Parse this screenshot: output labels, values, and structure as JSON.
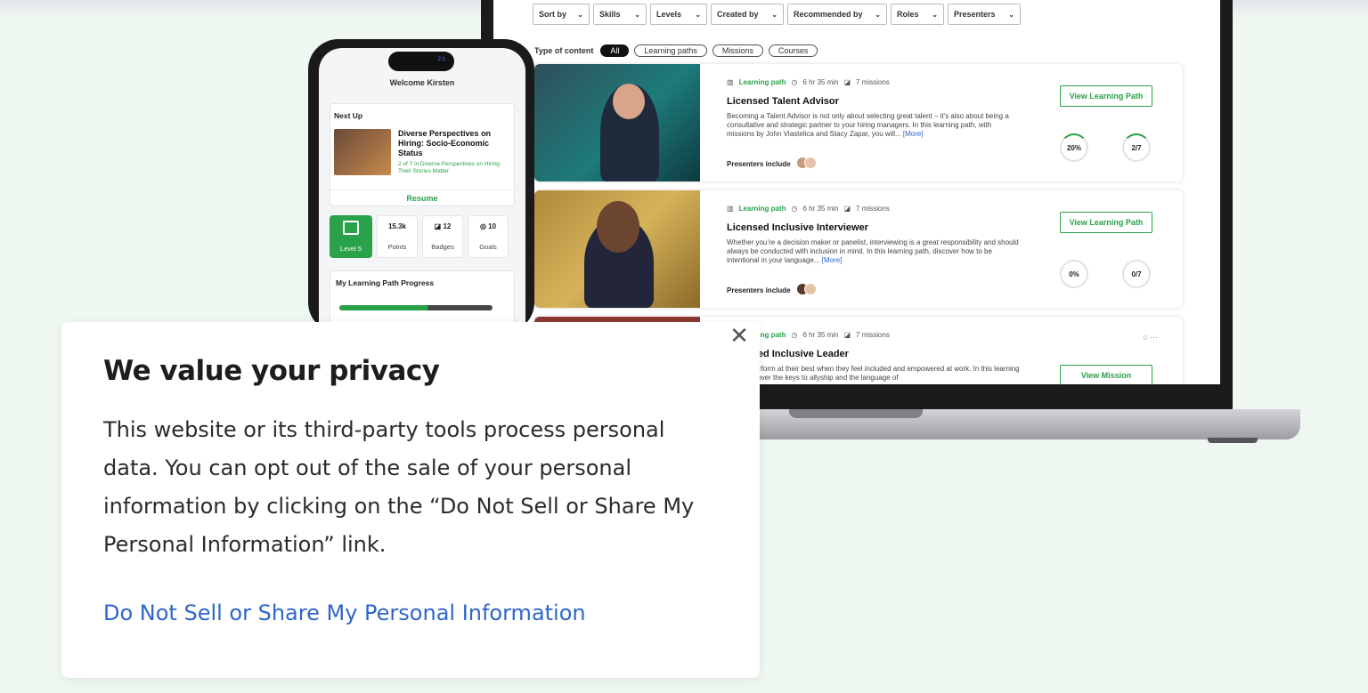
{
  "laptop": {
    "filters": [
      {
        "label": "Sort by",
        "width": 64
      },
      {
        "label": "Skills",
        "width": 60
      },
      {
        "label": "Levels",
        "width": 64
      },
      {
        "label": "Created by",
        "width": 82
      },
      {
        "label": "Recommended by",
        "width": 112
      },
      {
        "label": "Roles",
        "width": 60
      },
      {
        "label": "Presenters",
        "width": 82
      }
    ],
    "type_of_content_label": "Type of content",
    "chips": [
      "All",
      "Learning paths",
      "Missions",
      "Courses"
    ],
    "cards": [
      {
        "type": "Learning path",
        "duration": "6 hr 35 min",
        "missions": "7 missions",
        "title": "Licensed Talent Advisor",
        "description": "Becoming a Talent Advisor is not only about selecting great talent – it’s also about being a consultative and strategic partner to your hiring managers. In this learning path, with missions by John Vlastelica and Stacy Zapar, you will...",
        "more": "[More]",
        "presenters_label": "Presenters include",
        "button": "View Learning Path",
        "percent": "20%",
        "progress": "2/7"
      },
      {
        "type": "Learning path",
        "duration": "6 hr 35 min",
        "missions": "7 missions",
        "title": "Licensed Inclusive Interviewer",
        "description": "Whether you’re a decision maker or panelist, interviewing is a great responsibility and should always be conducted with inclusion in mind. In this learning path, discover how to be intentional in your language...",
        "more": "[More]",
        "presenters_label": "Presenters include",
        "button": "View Learning Path",
        "percent": "0%",
        "progress": "0/7"
      },
      {
        "type": "Learning path",
        "duration": "6 hr 35 min",
        "missions": "7 missions",
        "title": "Licensed Inclusive Leader",
        "description": "People perform at their best when they feel included and empowered at work. In this learning path, discover the keys to allyship and the language of",
        "button": "View Mission",
        "chat": "○ ···"
      }
    ]
  },
  "phone": {
    "status": "2:1",
    "welcome": "Welcome Kirsten",
    "next_up_label": "Next Up",
    "next_title": "Diverse Perspectives on Hiring: Socio-Economic Status",
    "next_sub": "2 of 7 in Diverse Perspectives on Hiring: Their Stories Matter",
    "resume": "Resume",
    "level": "Level 5",
    "stats": [
      {
        "icon": "star-icon",
        "value": "15.3k",
        "label": "Points"
      },
      {
        "icon": "badge-icon",
        "value": "12",
        "label": "Badges"
      },
      {
        "icon": "target-icon",
        "value": "10",
        "label": "Goals"
      }
    ],
    "progress_title": "My Learning Path Progress",
    "progress_fraction": 0.58
  },
  "privacy": {
    "title": "We value your privacy",
    "body": "This website or its third-party tools process personal data. You can opt out of the sale of your personal information by clicking on the “Do Not Sell or Share My Personal Information” link.",
    "link": "Do Not Sell or Share My Personal Information",
    "close": "✕"
  },
  "colors": {
    "accent": "#2aa24a",
    "link": "#2f66c9",
    "background": "#eef8f0"
  }
}
